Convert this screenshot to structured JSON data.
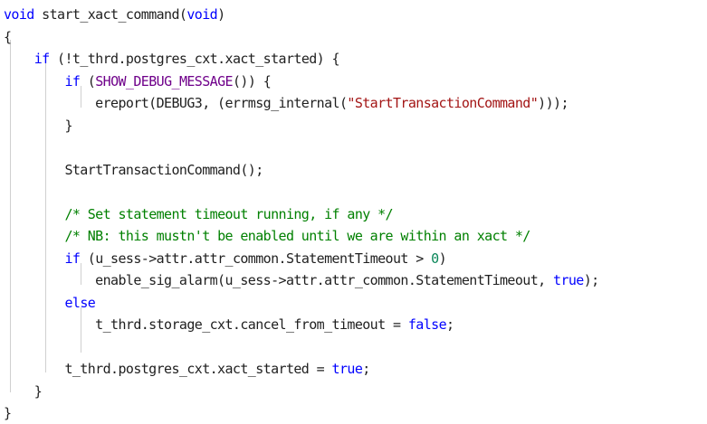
{
  "editor": {
    "colors": {
      "background": "#ffffff",
      "text": "#1f1f1f",
      "keyword": "#0000ff",
      "string": "#a31515",
      "comment": "#008000",
      "number": "#098658",
      "macro": "#6f008a",
      "guide": "#d0d0d0"
    },
    "lines": [
      [
        {
          "t": "void",
          "k": "keyword"
        },
        {
          "t": " start_xact_command(",
          "k": "text"
        },
        {
          "t": "void",
          "k": "keyword"
        },
        {
          "t": ")",
          "k": "text"
        }
      ],
      [
        {
          "t": "{",
          "k": "text"
        }
      ],
      [
        {
          "t": "    ",
          "k": "text"
        },
        {
          "t": "if",
          "k": "keyword"
        },
        {
          "t": " (!t_thrd.postgres_cxt.xact_started) {",
          "k": "text"
        }
      ],
      [
        {
          "t": "        ",
          "k": "text"
        },
        {
          "t": "if",
          "k": "keyword"
        },
        {
          "t": " (",
          "k": "text"
        },
        {
          "t": "SHOW_DEBUG_MESSAGE",
          "k": "macro"
        },
        {
          "t": "()) {",
          "k": "text"
        }
      ],
      [
        {
          "t": "            ereport(DEBUG3, (errmsg_internal(",
          "k": "text"
        },
        {
          "t": "\"StartTransactionCommand\"",
          "k": "string"
        },
        {
          "t": ")));",
          "k": "text"
        }
      ],
      [
        {
          "t": "        }",
          "k": "text"
        }
      ],
      [],
      [
        {
          "t": "        StartTransactionCommand();",
          "k": "text"
        }
      ],
      [],
      [
        {
          "t": "        ",
          "k": "text"
        },
        {
          "t": "/* Set statement timeout running, if any */",
          "k": "comment"
        }
      ],
      [
        {
          "t": "        ",
          "k": "text"
        },
        {
          "t": "/* NB: this mustn't be enabled until we are within an xact */",
          "k": "comment"
        }
      ],
      [
        {
          "t": "        ",
          "k": "text"
        },
        {
          "t": "if",
          "k": "keyword"
        },
        {
          "t": " (u_sess->attr.attr_common.StatementTimeout > ",
          "k": "text"
        },
        {
          "t": "0",
          "k": "number"
        },
        {
          "t": ")",
          "k": "text"
        }
      ],
      [
        {
          "t": "            enable_sig_alarm(u_sess->attr.attr_common.StatementTimeout, ",
          "k": "text"
        },
        {
          "t": "true",
          "k": "keyword"
        },
        {
          "t": ");",
          "k": "text"
        }
      ],
      [
        {
          "t": "        ",
          "k": "text"
        },
        {
          "t": "else",
          "k": "keyword"
        }
      ],
      [
        {
          "t": "            t_thrd.storage_cxt.cancel_from_timeout = ",
          "k": "text"
        },
        {
          "t": "false",
          "k": "keyword"
        },
        {
          "t": ";",
          "k": "text"
        }
      ],
      [],
      [
        {
          "t": "        t_thrd.postgres_cxt.xact_started = ",
          "k": "text"
        },
        {
          "t": "true",
          "k": "keyword"
        },
        {
          "t": ";",
          "k": "text"
        }
      ],
      [
        {
          "t": "    }",
          "k": "text"
        }
      ],
      [
        {
          "t": "}",
          "k": "text"
        }
      ]
    ]
  }
}
